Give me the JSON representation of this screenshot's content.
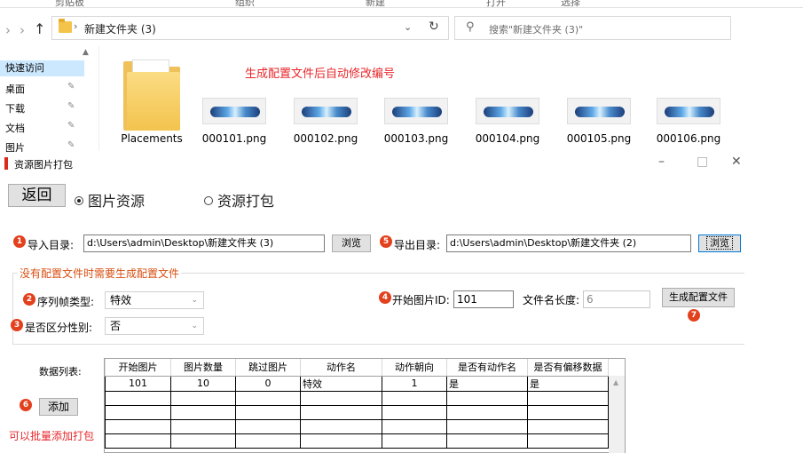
{
  "explorer": {
    "ribbon_tabs": [
      "剪贴板",
      "组织",
      "新建",
      "打开",
      "选择"
    ],
    "address_path": "新建文件夹 (3)",
    "search_placeholder": "搜索\"新建文件夹 (3)\"",
    "annotation": "生成配置文件后自动修改编号",
    "nav_items": [
      {
        "label": "快速访问",
        "active": true
      },
      {
        "label": "桌面",
        "pinned": true
      },
      {
        "label": "下载",
        "pinned": true
      },
      {
        "label": "文档",
        "pinned": true
      },
      {
        "label": "图片",
        "pinned": true
      }
    ],
    "files": [
      {
        "name": "Placements",
        "type": "folder"
      },
      {
        "name": "000101.png",
        "type": "image"
      },
      {
        "name": "000102.png",
        "type": "image"
      },
      {
        "name": "000103.png",
        "type": "image"
      },
      {
        "name": "000104.png",
        "type": "image"
      },
      {
        "name": "000105.png",
        "type": "image"
      },
      {
        "name": "000106.png",
        "type": "image"
      }
    ]
  },
  "app": {
    "title": "资源图片打包",
    "window_controls": {
      "minimize": "–",
      "maximize": "□",
      "close": "✕"
    },
    "back_button": "返回",
    "mode_radios": [
      {
        "label": "图片资源",
        "checked": true
      },
      {
        "label": "资源打包",
        "checked": false
      }
    ],
    "import": {
      "badge": "1",
      "label": "导入目录:",
      "value": "d:\\Users\\admin\\Desktop\\新建文件夹 (3)",
      "browse": "浏览"
    },
    "export": {
      "badge": "5",
      "label": "导出目录:",
      "value": "d:\\Users\\admin\\Desktop\\新建文件夹 (2)",
      "browse": "浏览"
    },
    "group_title": "没有配置文件时需要生成配置文件",
    "frame_type": {
      "badge": "2",
      "label": "序列帧类型:",
      "value": "特效"
    },
    "gender": {
      "badge": "3",
      "label": "是否区分性别:",
      "value": "否"
    },
    "start_id": {
      "badge": "4",
      "label": "开始图片ID:",
      "value": "101"
    },
    "filename_len": {
      "label": "文件名长度:",
      "value": "6"
    },
    "generate_button": "生成配置文件",
    "generate_badge": "7",
    "data_list_label": "数据列表:",
    "add": {
      "badge": "6",
      "label": "添加"
    },
    "batch_note": "可以批量添加打包",
    "table": {
      "columns": [
        "开始图片",
        "图片数量",
        "跳过图片",
        "动作名",
        "动作朝向",
        "是否有动作名",
        "是否有偏移数据"
      ],
      "rows": [
        [
          "101",
          "10",
          "0",
          "特效",
          "1",
          "是",
          "是"
        ]
      ]
    }
  }
}
